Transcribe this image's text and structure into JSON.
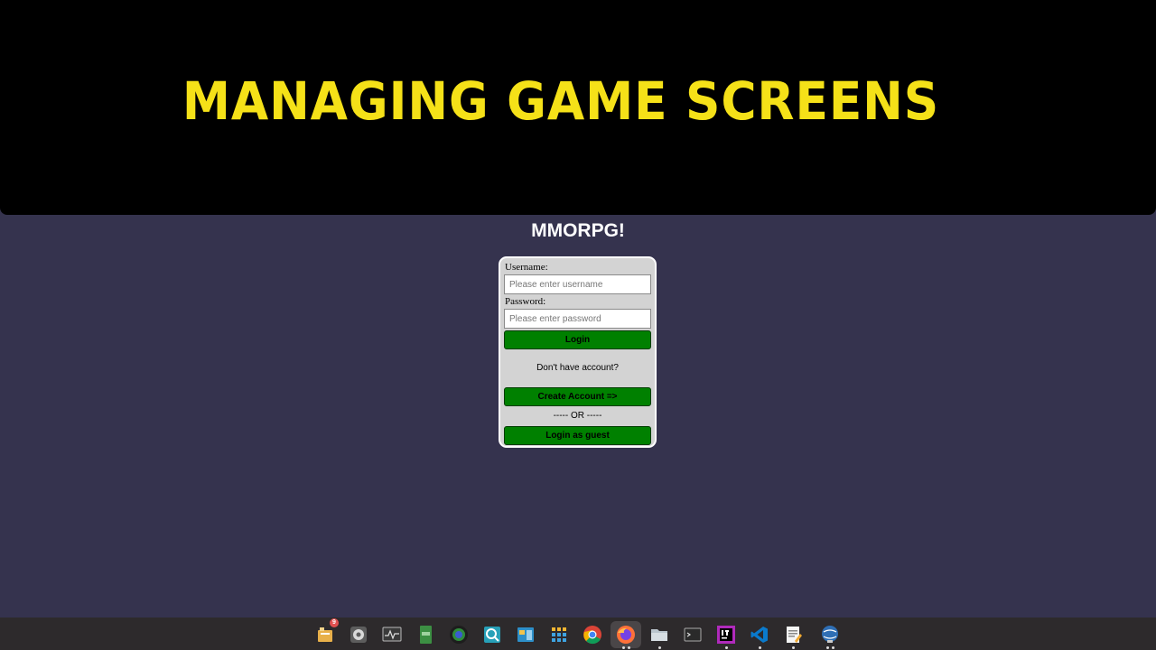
{
  "banner": {
    "title": "MANAGING GAME SCREENS"
  },
  "app": {
    "title": "MMORPG!"
  },
  "login": {
    "username_label": "Username:",
    "username_placeholder": "Please enter username",
    "password_label": "Password:",
    "password_placeholder": "Please enter password",
    "login_button": "Login",
    "no_account_text": "Don't have account?",
    "create_account_button": "Create Account =>",
    "or_separator": "----- OR -----",
    "guest_button": "Login as guest"
  },
  "taskbar": {
    "items": [
      {
        "icon": "notes-icon",
        "badge": "9"
      },
      {
        "icon": "settings-icon"
      },
      {
        "icon": "system-monitor-icon"
      },
      {
        "icon": "notebook-icon"
      },
      {
        "icon": "globe-app-icon"
      },
      {
        "icon": "search-app-icon"
      },
      {
        "icon": "window-manager-icon"
      },
      {
        "icon": "app-grid-icon"
      },
      {
        "icon": "chrome-icon"
      },
      {
        "icon": "firefox-icon"
      },
      {
        "icon": "file-manager-icon"
      },
      {
        "icon": "terminal-icon"
      },
      {
        "icon": "intellij-icon"
      },
      {
        "icon": "vscode-icon"
      },
      {
        "icon": "text-editor-icon"
      },
      {
        "icon": "network-globe-icon"
      }
    ]
  },
  "colors": {
    "background": "#35334e",
    "banner_bg": "#000000",
    "banner_text": "#f5e118",
    "button_green": "#008000",
    "panel_bg": "#d3d3d3"
  }
}
